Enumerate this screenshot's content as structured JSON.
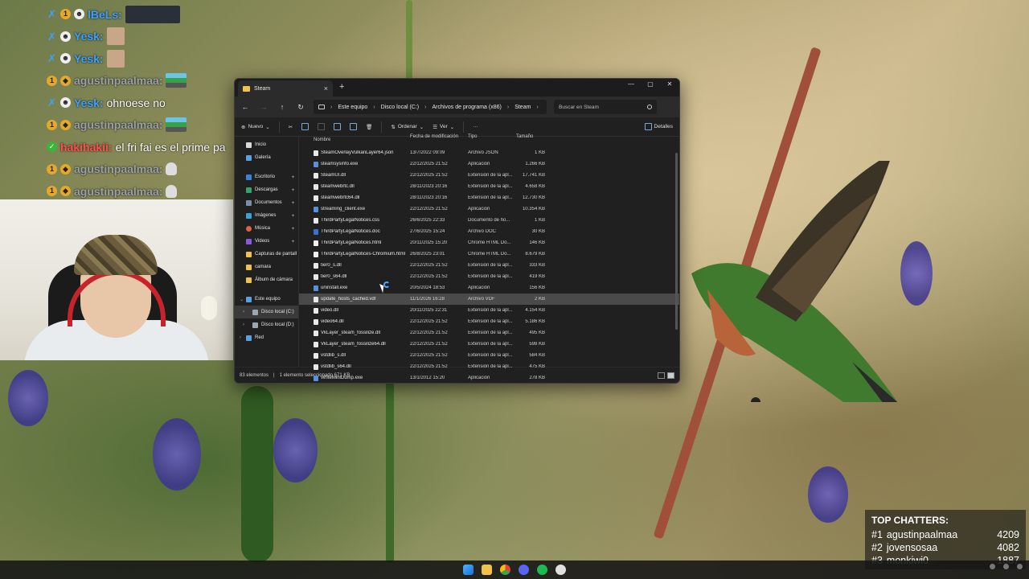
{
  "chat": [
    {
      "badges": [
        "blue-sword",
        "gold",
        "white"
      ],
      "user": "lBeLs:",
      "user_color": "#3ea0ff",
      "message": "",
      "emote": "wide"
    },
    {
      "badges": [
        "blue-sword",
        "white"
      ],
      "user": "Yesk:",
      "user_color": "#3ea0ff",
      "message": "",
      "emote": "avatar"
    },
    {
      "badges": [
        "blue-sword",
        "white"
      ],
      "user": "Yesk:",
      "user_color": "#3ea0ff",
      "message": "",
      "emote": "avatar"
    },
    {
      "badges": [
        "gold",
        "gold"
      ],
      "user": "agustinpaalmaa:",
      "user_color": "#9aa0a6",
      "message": "",
      "emote": "flag"
    },
    {
      "badges": [
        "blue-sword",
        "white"
      ],
      "user": "Yesk:",
      "user_color": "#3ea0ff",
      "message": "ohnoese no",
      "emote": ""
    },
    {
      "badges": [
        "gold",
        "gold"
      ],
      "user": "agustinpaalmaa:",
      "user_color": "#9aa0a6",
      "message": "",
      "emote": "flag"
    },
    {
      "badges": [
        "green"
      ],
      "user": "hakihakii:",
      "user_color": "#ff4f4f",
      "message": "el fri fai es el prime pa",
      "emote": ""
    },
    {
      "badges": [
        "gold",
        "gold"
      ],
      "user": "agustinpaalmaa:",
      "user_color": "#9aa0a6",
      "message": "",
      "emote": "skull"
    },
    {
      "badges": [
        "gold",
        "gold"
      ],
      "user": "agustinpaalmaa:",
      "user_color": "#9aa0a6",
      "message": "",
      "emote": "skull"
    }
  ],
  "explorer": {
    "tab_title": "Steam",
    "breadcrumb": [
      "Este equipo",
      "Disco local (C:)",
      "Archivos de programa (x86)",
      "Steam"
    ],
    "search_placeholder": "Buscar en Steam",
    "cmd": {
      "new": "Nuevo",
      "sort": "Ordenar",
      "view": "Ver",
      "more": "···",
      "details": "Detalles"
    },
    "nav": {
      "top": [
        {
          "label": "Inicio",
          "icon": "home-icon",
          "color": "#d9d9d9"
        },
        {
          "label": "Galería",
          "icon": "gallery-icon",
          "color": "#5aa0e6"
        }
      ],
      "pinned": [
        {
          "label": "Escritorio",
          "icon": "desktop-icon",
          "color": "#3b82d6"
        },
        {
          "label": "Descargas",
          "icon": "downloads-icon",
          "color": "#2fa36b"
        },
        {
          "label": "Documentos",
          "icon": "documents-icon",
          "color": "#7a8ea8"
        },
        {
          "label": "Imágenes",
          "icon": "images-icon",
          "color": "#3aa0d8"
        },
        {
          "label": "Música",
          "icon": "music-icon",
          "color": "#e0604a"
        },
        {
          "label": "Videos",
          "icon": "videos-icon",
          "color": "#8a5ad6"
        },
        {
          "label": "Capturas de pantall",
          "icon": "folder-icon",
          "color": "#f0c24b"
        },
        {
          "label": "camara",
          "icon": "folder-icon",
          "color": "#f0c24b"
        },
        {
          "label": "Álbum de cámara",
          "icon": "folder-icon",
          "color": "#f0c24b"
        }
      ],
      "tree": [
        {
          "label": "Este equipo",
          "icon": "computer-icon",
          "color": "#5aa0e6",
          "chev": "⌄",
          "level": 0
        },
        {
          "label": "Disco local (C:)",
          "icon": "drive-icon",
          "color": "#9aa7b4",
          "chev": "›",
          "level": 1
        },
        {
          "label": "Disco local (D:)",
          "icon": "drive-icon",
          "color": "#9aa7b4",
          "chev": "›",
          "level": 1
        },
        {
          "label": "Red",
          "icon": "network-icon",
          "color": "#5aa0e6",
          "chev": "›",
          "level": 0
        }
      ]
    },
    "columns": {
      "name": "Nombre",
      "date": "Fecha de modificación",
      "type": "Tipo",
      "size": "Tamaño"
    },
    "files": [
      {
        "name": "SteamOverlayVulkanLayer64.json",
        "date": "13/7/2022 09:09",
        "type": "Archivo JSON",
        "size": "1 KB",
        "kind": "file"
      },
      {
        "name": "steamsysinfo.exe",
        "date": "22/12/2025 21:52",
        "type": "Aplicación",
        "size": "1.266 KB",
        "kind": "exe"
      },
      {
        "name": "SteamUI.dll",
        "date": "22/12/2025 21:52",
        "type": "Extensión de la apl...",
        "size": "17.741 KB",
        "kind": "file"
      },
      {
        "name": "steamwebrtc.dll",
        "date": "28/11/2023 20:16",
        "type": "Extensión de la apl...",
        "size": "4.658 KB",
        "kind": "file"
      },
      {
        "name": "steamwebrtc64.dll",
        "date": "28/11/2023 20:16",
        "type": "Extensión de la apl...",
        "size": "12.730 KB",
        "kind": "file"
      },
      {
        "name": "streaming_client.exe",
        "date": "22/12/2025 21:52",
        "type": "Aplicación",
        "size": "10.354 KB",
        "kind": "exe"
      },
      {
        "name": "ThirdPartyLegalNotices.css",
        "date": "26/6/2025 22:33",
        "type": "Documento de ho...",
        "size": "1 KB",
        "kind": "file"
      },
      {
        "name": "ThirdPartyLegalNotices.doc",
        "date": "27/6/2025 15:24",
        "type": "Archivo DOC",
        "size": "30 KB",
        "kind": "doc"
      },
      {
        "name": "ThirdPartyLegalNotices.html",
        "date": "20/11/2025 15:20",
        "type": "Chrome HTML Do...",
        "size": "146 KB",
        "kind": "html"
      },
      {
        "name": "ThirdPartyLegalNotices-Chromium.html",
        "date": "26/8/2025 23:01",
        "type": "Chrome HTML Do...",
        "size": "8.679 KB",
        "kind": "html"
      },
      {
        "name": "tier0_s.dll",
        "date": "22/12/2025 21:52",
        "type": "Extensión de la apl...",
        "size": "333 KB",
        "kind": "file"
      },
      {
        "name": "tier0_s64.dll",
        "date": "22/12/2025 21:52",
        "type": "Extensión de la apl...",
        "size": "419 KB",
        "kind": "file"
      },
      {
        "name": "uninstall.exe",
        "date": "20/5/2024 18:53",
        "type": "Aplicación",
        "size": "156 KB",
        "kind": "exe"
      },
      {
        "name": "update_hosts_cached.vdf",
        "date": "11/1/2026 16:28",
        "type": "Archivo VDF",
        "size": "2 KB",
        "kind": "file",
        "selected": true
      },
      {
        "name": "video.dll",
        "date": "20/11/2025 22:31",
        "type": "Extensión de la apl...",
        "size": "4.154 KB",
        "kind": "file"
      },
      {
        "name": "video64.dll",
        "date": "22/12/2025 21:52",
        "type": "Extensión de la apl...",
        "size": "5.186 KB",
        "kind": "file"
      },
      {
        "name": "VkLayer_steam_fossilize.dll",
        "date": "22/12/2025 21:52",
        "type": "Extensión de la apl...",
        "size": "495 KB",
        "kind": "file"
      },
      {
        "name": "VkLayer_steam_fossilize64.dll",
        "date": "22/12/2025 21:52",
        "type": "Extensión de la apl...",
        "size": "598 KB",
        "kind": "file"
      },
      {
        "name": "vstdlib_s.dll",
        "date": "22/12/2025 21:52",
        "type": "Extensión de la apl...",
        "size": "584 KB",
        "kind": "file"
      },
      {
        "name": "vstdlib_s64.dll",
        "date": "22/12/2025 21:52",
        "type": "Extensión de la apl...",
        "size": "475 KB",
        "kind": "file"
      },
      {
        "name": "WriteMiniDump.exe",
        "date": "13/1/2012 15:20",
        "type": "Aplicación",
        "size": "278 KB",
        "kind": "exe"
      }
    ],
    "status": {
      "count": "83 elementos",
      "selection": "1 elemento seleccionado 671 KB"
    }
  },
  "top_chatters": {
    "title": "TOP CHATTERS:",
    "rows": [
      {
        "rank": "#1",
        "name": "agustinpaalmaa",
        "count": "4209"
      },
      {
        "rank": "#2",
        "name": "jovensosaa",
        "count": "4082"
      },
      {
        "rank": "#3",
        "name": "monkiwi0",
        "count": "1887"
      }
    ]
  },
  "colors": {
    "accent": "#4fa3ff",
    "selection": "#4a4a4a",
    "window_bg": "#202020"
  }
}
